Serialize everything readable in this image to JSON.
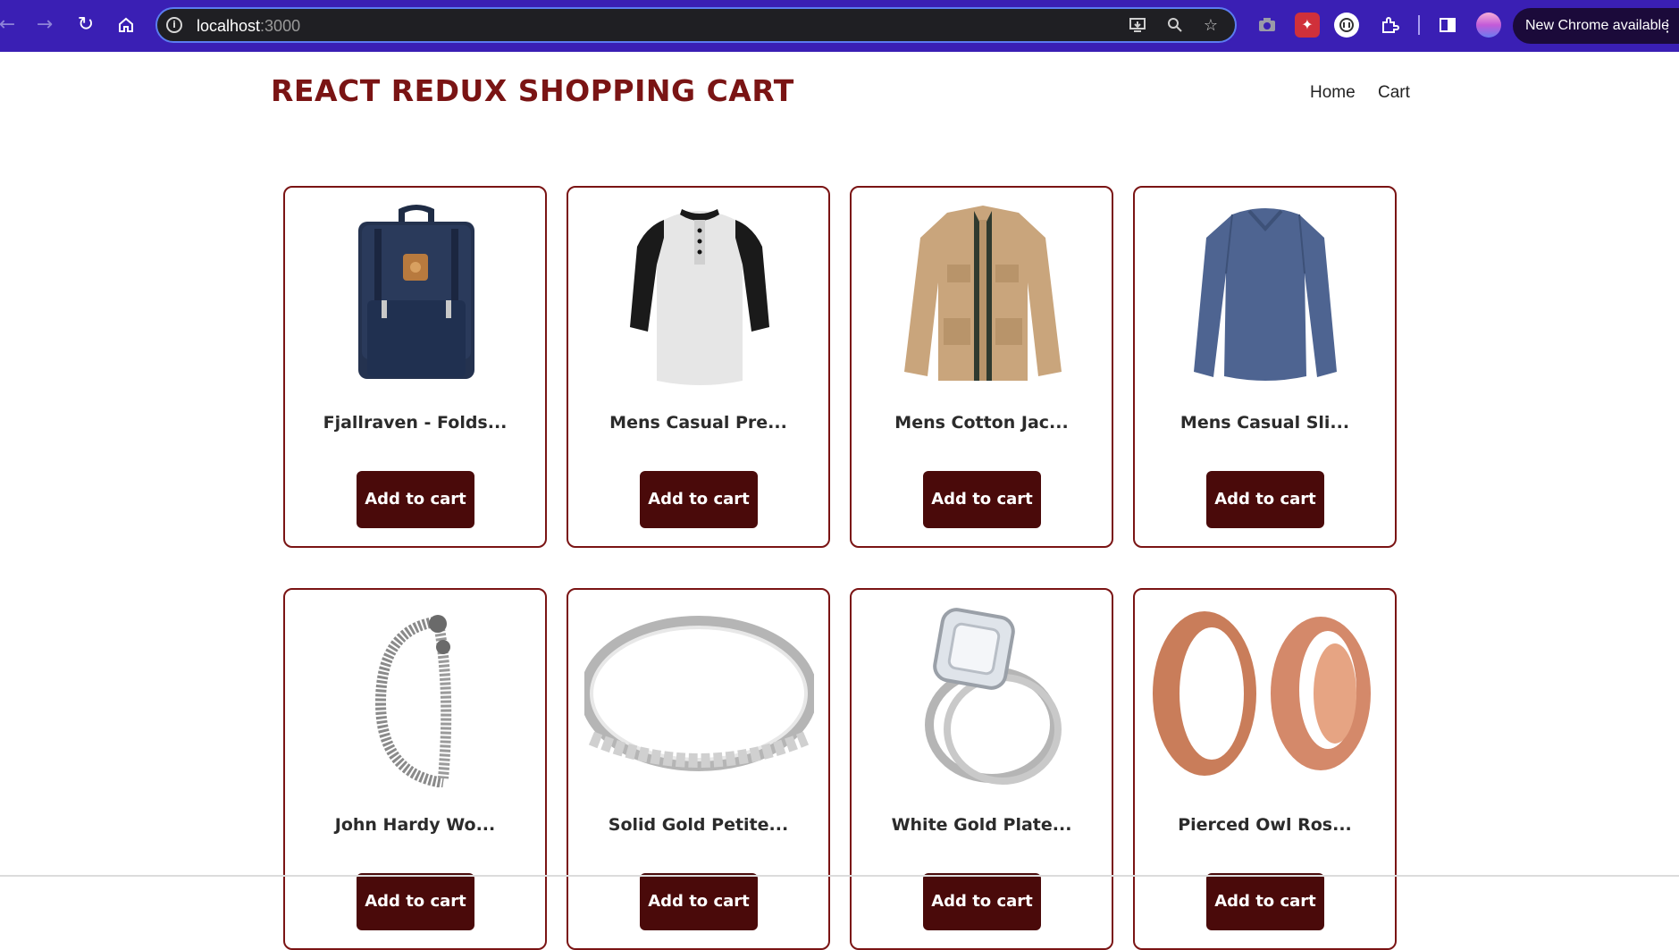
{
  "browser": {
    "url_host": "localhost",
    "url_port": ":3000",
    "update_label": "New Chrome available",
    "icons": [
      "back-icon",
      "forward-icon",
      "reload-icon",
      "home-icon",
      "site-info-icon",
      "install-app-icon",
      "zoom-icon",
      "bookmark-star-icon",
      "camera-extension-icon",
      "game-extension-icon",
      "circle-extension-icon",
      "extensions-puzzle-icon",
      "side-panel-icon",
      "profile-avatar",
      "more-menu-icon"
    ]
  },
  "header": {
    "brand": "REACT REDUX SHOPPING CART",
    "nav": {
      "home": "Home",
      "cart": "Cart"
    }
  },
  "products": [
    {
      "title": "Fjallraven - Folds...",
      "button": "Add to cart",
      "image": "backpack"
    },
    {
      "title": "Mens Casual Pre...",
      "button": "Add to cart",
      "image": "raglan-tee"
    },
    {
      "title": "Mens Cotton Jac...",
      "button": "Add to cart",
      "image": "cotton-jacket"
    },
    {
      "title": "Mens Casual Sli...",
      "button": "Add to cart",
      "image": "slim-tee"
    },
    {
      "title": "John Hardy Wo...",
      "button": "Add to cart",
      "image": "dragon-bracelet"
    },
    {
      "title": "Solid Gold Petite...",
      "button": "Add to cart",
      "image": "bangle"
    },
    {
      "title": "White Gold Plate...",
      "button": "Add to cart",
      "image": "ring"
    },
    {
      "title": "Pierced Owl Ros...",
      "button": "Add to cart",
      "image": "plugs"
    }
  ],
  "colors": {
    "brand": "#7a1414",
    "button": "#4a0a0a",
    "chrome": "#3a1fb4"
  }
}
